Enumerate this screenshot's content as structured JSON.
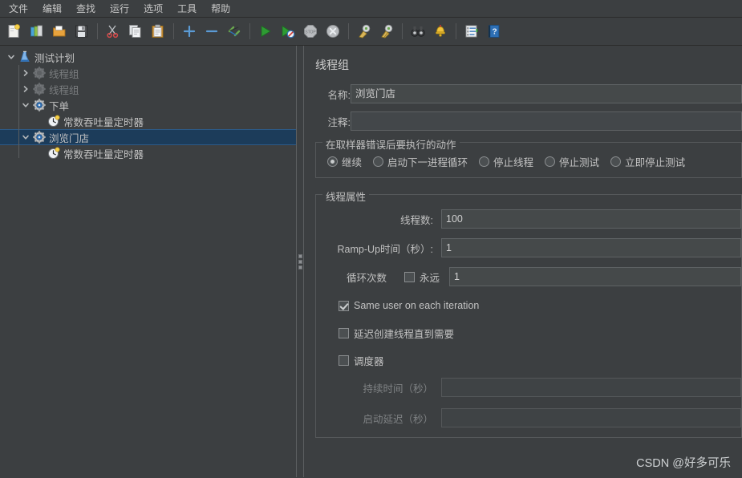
{
  "menubar": {
    "items": [
      {
        "label": "文件",
        "name": "menu-file"
      },
      {
        "label": "编辑",
        "name": "menu-edit"
      },
      {
        "label": "查找",
        "name": "menu-search"
      },
      {
        "label": "运行",
        "name": "menu-run"
      },
      {
        "label": "选项",
        "name": "menu-options"
      },
      {
        "label": "工具",
        "name": "menu-tools"
      },
      {
        "label": "帮助",
        "name": "menu-help"
      }
    ]
  },
  "toolbar": {
    "buttons": [
      {
        "icon": "new-document-icon",
        "label": "新建"
      },
      {
        "icon": "templates-icon",
        "label": "模板"
      },
      {
        "icon": "open-folder-icon",
        "label": "打开"
      },
      {
        "icon": "save-icon",
        "label": "保存"
      },
      {
        "sep": true
      },
      {
        "icon": "cut-scissors-icon",
        "label": "剪切"
      },
      {
        "icon": "copy-icon",
        "label": "复制"
      },
      {
        "icon": "paste-clipboard-icon",
        "label": "粘贴"
      },
      {
        "sep": true
      },
      {
        "icon": "expand-plus-icon",
        "label": "展开全部"
      },
      {
        "icon": "collapse-minus-icon",
        "label": "收起全部"
      },
      {
        "icon": "toggle-pen-icon",
        "label": "切换"
      },
      {
        "sep": true
      },
      {
        "icon": "start-play-icon",
        "label": "启动"
      },
      {
        "icon": "start-no-pause-icon",
        "label": "无间隔启动"
      },
      {
        "icon": "stop-sign-icon",
        "label": "停止"
      },
      {
        "icon": "shutdown-x-icon",
        "label": "关闭"
      },
      {
        "sep": true
      },
      {
        "icon": "clear-broom-icon",
        "label": "清除"
      },
      {
        "icon": "clear-all-broom-icon",
        "label": "清除全部"
      },
      {
        "sep": true
      },
      {
        "icon": "search-binoculars-icon",
        "label": "搜索"
      },
      {
        "icon": "reset-search-bell-icon",
        "label": "重置搜索"
      },
      {
        "sep": true
      },
      {
        "icon": "function-helper-icon",
        "label": "函数助手对话框"
      },
      {
        "icon": "help-book-icon",
        "label": "帮助"
      }
    ]
  },
  "tree": {
    "nodes": [
      {
        "label": "测试计划",
        "icon": "test-plan-flask-icon",
        "depth": 0,
        "toggle": "expanded",
        "disabled": false,
        "selected": false,
        "name": "tree-node-test-plan"
      },
      {
        "label": "线程组",
        "icon": "thread-group-gear-icon",
        "depth": 1,
        "toggle": "collapsed",
        "disabled": true,
        "selected": false,
        "name": "tree-node-thread-group-1"
      },
      {
        "label": "线程组",
        "icon": "thread-group-gear-icon",
        "depth": 1,
        "toggle": "collapsed",
        "disabled": true,
        "selected": false,
        "name": "tree-node-thread-group-2"
      },
      {
        "label": "下单",
        "icon": "thread-group-gear-icon",
        "depth": 1,
        "toggle": "expanded",
        "disabled": false,
        "selected": false,
        "name": "tree-node-xiadan"
      },
      {
        "label": "常数吞吐量定时器",
        "icon": "timer-clock-icon",
        "depth": 2,
        "toggle": "none",
        "disabled": false,
        "selected": false,
        "name": "tree-node-timer-1"
      },
      {
        "label": "浏览门店",
        "icon": "thread-group-gear-icon",
        "depth": 1,
        "toggle": "expanded",
        "disabled": false,
        "selected": true,
        "name": "tree-node-liulanmendian"
      },
      {
        "label": "常数吞吐量定时器",
        "icon": "timer-clock-icon",
        "depth": 2,
        "toggle": "none",
        "disabled": false,
        "selected": false,
        "name": "tree-node-timer-2"
      }
    ]
  },
  "panel": {
    "title": "线程组",
    "name_label": "名称:",
    "name_value": "浏览门店",
    "comment_label": "注释:",
    "comment_value": "",
    "error_action": {
      "title": "在取样器错误后要执行的动作",
      "options": [
        {
          "label": "继续",
          "checked": true,
          "name": "radio-continue"
        },
        {
          "label": "启动下一进程循环",
          "checked": false,
          "name": "radio-start-next-loop"
        },
        {
          "label": "停止线程",
          "checked": false,
          "name": "radio-stop-thread"
        },
        {
          "label": "停止测试",
          "checked": false,
          "name": "radio-stop-test"
        },
        {
          "label": "立即停止测试",
          "checked": false,
          "name": "radio-stop-test-now"
        }
      ]
    },
    "thread_properties": {
      "title": "线程属性",
      "num_threads_label": "线程数:",
      "num_threads_value": "100",
      "ramp_up_label": "Ramp-Up时间（秒）:",
      "ramp_up_value": "1",
      "loop_count_label": "循环次数",
      "forever_label": "永远",
      "forever_checked": false,
      "loop_count_value": "1",
      "same_user_label": "Same user on each iteration",
      "same_user_checked": true,
      "delay_create_label": "延迟创建线程直到需要",
      "delay_create_checked": false,
      "scheduler_label": "调度器",
      "scheduler_checked": false,
      "duration_label": "持续时间（秒）",
      "duration_value": "",
      "startup_delay_label": "启动延迟（秒）",
      "startup_delay_value": ""
    }
  },
  "watermark": "CSDN @好多可乐",
  "colors": {
    "background": "#3c3f41",
    "selection": "#1c3c5a",
    "text": "#c3c3c3",
    "disabled_text": "#7a7d7f",
    "field_bg": "#45494a",
    "border": "#55585a"
  }
}
